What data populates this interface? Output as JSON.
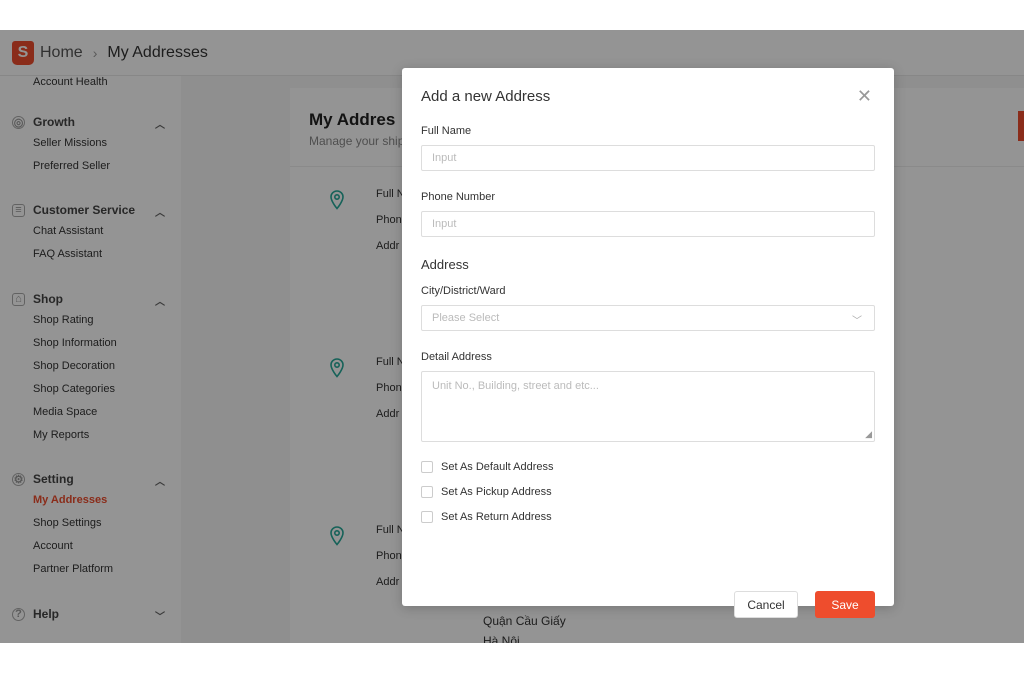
{
  "header": {
    "logo_letter": "S",
    "breadcrumb": {
      "home": "Home",
      "separator": "›",
      "current": "My Addresses"
    }
  },
  "sidebar": {
    "top_item": "Account Health",
    "groups": [
      {
        "title": "Growth",
        "icon": "target-icon",
        "items": [
          "Seller Missions",
          "Preferred Seller"
        ]
      },
      {
        "title": "Customer Service",
        "icon": "chat-icon",
        "items": [
          "Chat Assistant",
          "FAQ Assistant"
        ]
      },
      {
        "title": "Shop",
        "icon": "shop-icon",
        "items": [
          "Shop Rating",
          "Shop Information",
          "Shop Decoration",
          "Shop Categories",
          "Media Space",
          "My Reports"
        ]
      },
      {
        "title": "Setting",
        "icon": "gear-icon",
        "items": [
          "My Addresses",
          "Shop Settings",
          "Account",
          "Partner Platform"
        ],
        "active": "My Addresses"
      },
      {
        "title": "Help",
        "icon": "help-icon",
        "items": []
      }
    ]
  },
  "content": {
    "title": "My Addres",
    "subtitle": "Manage your ship",
    "row_labels": {
      "name": "Full N",
      "phone": "Phon",
      "address": "Addr"
    },
    "address_lines": [
      "Quận Cầu Giấy",
      "Hà Nội"
    ],
    "accent": "#26aa99"
  },
  "modal": {
    "title": "Add a new Address",
    "full_name_label": "Full Name",
    "full_name_placeholder": "Input",
    "phone_label": "Phone Number",
    "phone_placeholder": "Input",
    "address_section": "Address",
    "city_label": "City/District/Ward",
    "city_placeholder": "Please Select",
    "detail_label": "Detail Address",
    "detail_placeholder": "Unit No., Building, street and etc...",
    "checkboxes": [
      "Set As Default Address",
      "Set As Pickup Address",
      "Set As Return Address"
    ],
    "cancel_label": "Cancel",
    "save_label": "Save",
    "brand_color": "#ee4d2d"
  }
}
